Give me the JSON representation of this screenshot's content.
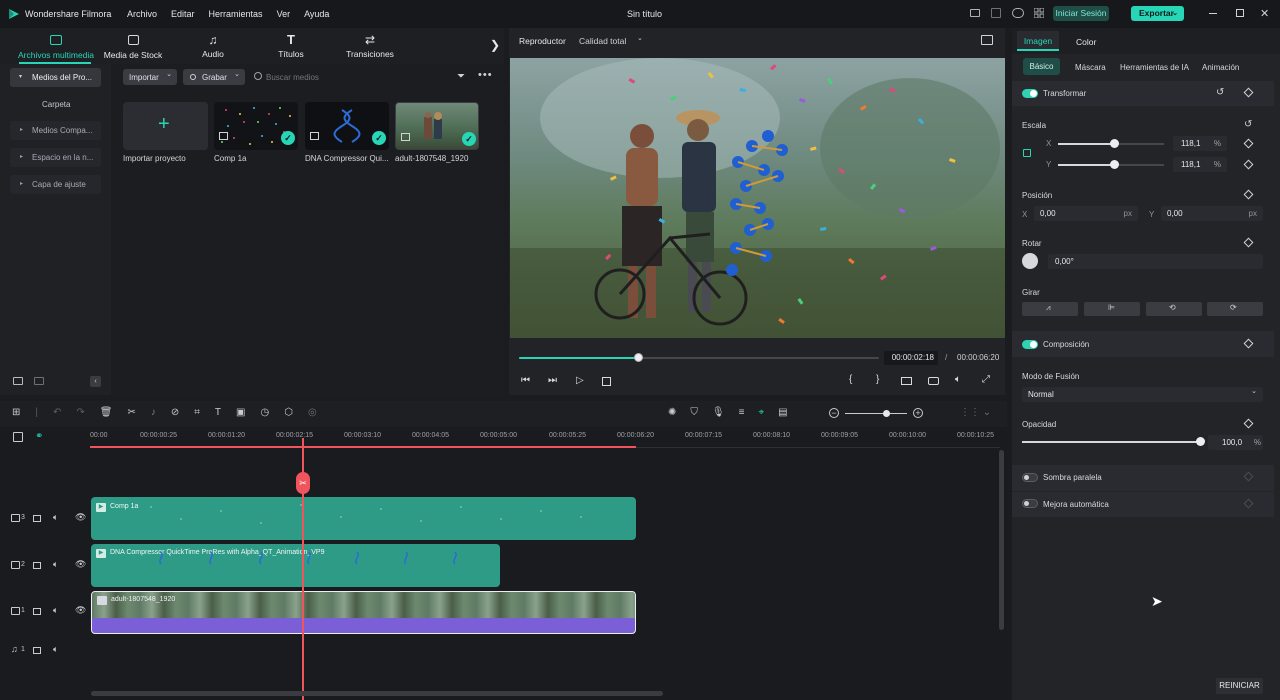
{
  "app": {
    "title": "Wondershare Filmora",
    "doc_title": "Sin título"
  },
  "menu": [
    "Archivo",
    "Editar",
    "Herramientas",
    "Ver",
    "Ayuda"
  ],
  "header_buttons": {
    "login": "Iniciar Sesión",
    "export": "Exportar"
  },
  "media_tabs": [
    {
      "label": "Archivos multimedia",
      "icon": "media-icon",
      "active": true
    },
    {
      "label": "Media de Stock",
      "icon": "stock-icon"
    },
    {
      "label": "Audio",
      "icon": "music-icon"
    },
    {
      "label": "Títulos",
      "icon": "title-icon"
    },
    {
      "label": "Transiciones",
      "icon": "transition-icon"
    }
  ],
  "sidebar": {
    "items": [
      "Medios del Pro...",
      "Carpeta",
      "Medios Compa...",
      "Espacio en la n...",
      "Capa de ajuste"
    ]
  },
  "media_toolbar": {
    "import": "Importar",
    "record": "Grabar",
    "search_placeholder": "Buscar medios"
  },
  "media_items": [
    {
      "name": "Importar proyecto"
    },
    {
      "name": "Comp 1a"
    },
    {
      "name": "DNA Compressor Qui..."
    },
    {
      "name": "adult-1807548_1920"
    }
  ],
  "player": {
    "label": "Reproductor",
    "quality": "Calidad total",
    "progress": 0.33,
    "current_time": "00:00:02:18",
    "separator": "/",
    "total_time": "00:00:06:20"
  },
  "properties": {
    "tabs": [
      "Imagen",
      "Color"
    ],
    "subtabs": [
      "Básico",
      "Máscara",
      "Herramientas de IA",
      "Animación"
    ],
    "transform": "Transformar",
    "scale": {
      "label": "Escala",
      "x_label": "X",
      "y_label": "Y",
      "x": "118,1",
      "y": "118,1",
      "unit": "%",
      "fraction": 0.53
    },
    "position": {
      "label": "Posición",
      "x_label": "X",
      "y_label": "Y",
      "x": "0,00",
      "y": "0,00",
      "unit": "px"
    },
    "rotate": {
      "label": "Rotar",
      "value": "0,00°"
    },
    "flip": {
      "label": "Girar"
    },
    "composition": "Composición",
    "blend": {
      "label": "Modo de Fusión",
      "value": "Normal"
    },
    "opacity": {
      "label": "Opacidad",
      "value": "100,0",
      "unit": "%",
      "fraction": 1.0
    },
    "shadow": "Sombra paralela",
    "auto_enhance": "Mejora automática",
    "reset": "REINICIAR"
  },
  "timeline": {
    "ruler": [
      "00:00",
      "00:00:00:25",
      "00:00:01:20",
      "00:00:02:15",
      "00:00:03:10",
      "00:00:04:05",
      "00:00:05:00",
      "00:00:05:25",
      "00:00:06:20",
      "00:00:07:15",
      "00:00:08:10",
      "00:00:09:05",
      "00:00:10:00",
      "00:00:10:25"
    ],
    "tracks": [
      {
        "num": "3",
        "clip": "Comp 1a"
      },
      {
        "num": "2",
        "clip": "DNA Compressor QuickTime ProRes with Alpha_QT_Animation_VP9"
      },
      {
        "num": "1",
        "clip": "adult-1807548_1920"
      },
      {
        "num": "1",
        "clip": ""
      }
    ]
  },
  "colors": {
    "accent": "#27d6b7",
    "playhead": "#f0545c",
    "clip_teal": "#2e9b87",
    "clip_purple": "#7a5fd6"
  }
}
